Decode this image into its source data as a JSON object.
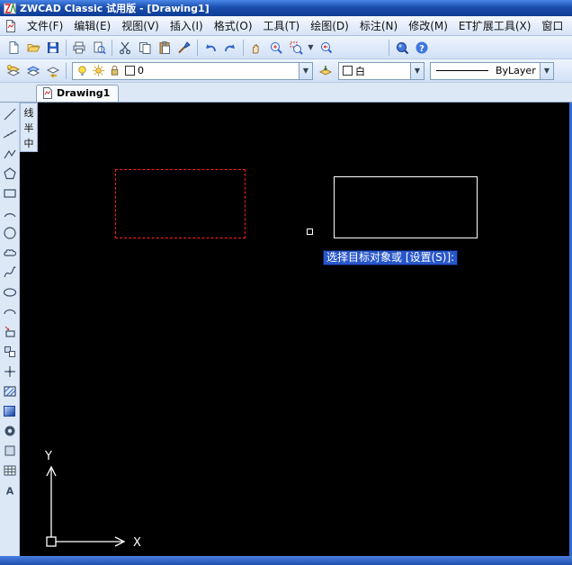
{
  "window": {
    "title": "ZWCAD Classic 试用版 - [Drawing1]"
  },
  "menu": {
    "items": [
      "文件(F)",
      "编辑(E)",
      "视图(V)",
      "插入(I)",
      "格式(O)",
      "工具(T)",
      "绘图(D)",
      "标注(N)",
      "修改(M)",
      "ET扩展工具(X)",
      "窗口"
    ]
  },
  "standard_toolbar": {
    "icons": [
      "new-icon",
      "open-icon",
      "save-icon",
      "plot-icon",
      "preview-icon",
      "cut-icon",
      "copy-icon",
      "paste-icon",
      "match-properties-icon",
      "undo-icon",
      "redo-icon",
      "pan-icon",
      "zoom-realtime-icon",
      "zoom-window-icon",
      "zoom-previous-icon",
      "find-icon",
      "help-icon"
    ]
  },
  "properties_toolbar": {
    "icons": [
      "layer-properties-icon",
      "layer-states-icon",
      "layer-previous-icon"
    ],
    "layer": {
      "value": "0",
      "indicators": [
        "bulb-icon",
        "freeze-icon",
        "lock-icon",
        "color-swatch"
      ]
    },
    "color": {
      "value": "白"
    },
    "linetype": {
      "value": "ByLayer"
    }
  },
  "document_tabs": [
    {
      "label": "Drawing1"
    }
  ],
  "draw_toolbar": {
    "tools": [
      "line",
      "construction-line",
      "polyline",
      "polygon",
      "rectangle",
      "arc",
      "circle",
      "revision-cloud",
      "spline",
      "ellipse",
      "ellipse-arc",
      "insert-block",
      "make-block",
      "point",
      "hatch",
      "gradient",
      "donut",
      "region",
      "table",
      "multiline-text"
    ]
  },
  "floating_toolbar": {
    "buttons": [
      "线",
      "半",
      "中"
    ]
  },
  "canvas": {
    "prompt": "选择目标对象或 [设置(S)]:",
    "ucs": {
      "x_label": "X",
      "y_label": "Y"
    },
    "shapes": {
      "selected_rectangle": {
        "stroke": "#ff2020",
        "style": "dashed"
      },
      "rectangle": {
        "stroke": "#ffffff",
        "style": "solid"
      }
    }
  },
  "glyphs": {
    "help": "?",
    "mtext": "A"
  },
  "colors": {
    "titlebar": "#1b4fae",
    "toolbar_bg": "#d2e1f6",
    "canvas_bg": "#000000",
    "selection_bg": "#2857c9",
    "selected_object": "#ff2020",
    "object": "#ffffff"
  }
}
